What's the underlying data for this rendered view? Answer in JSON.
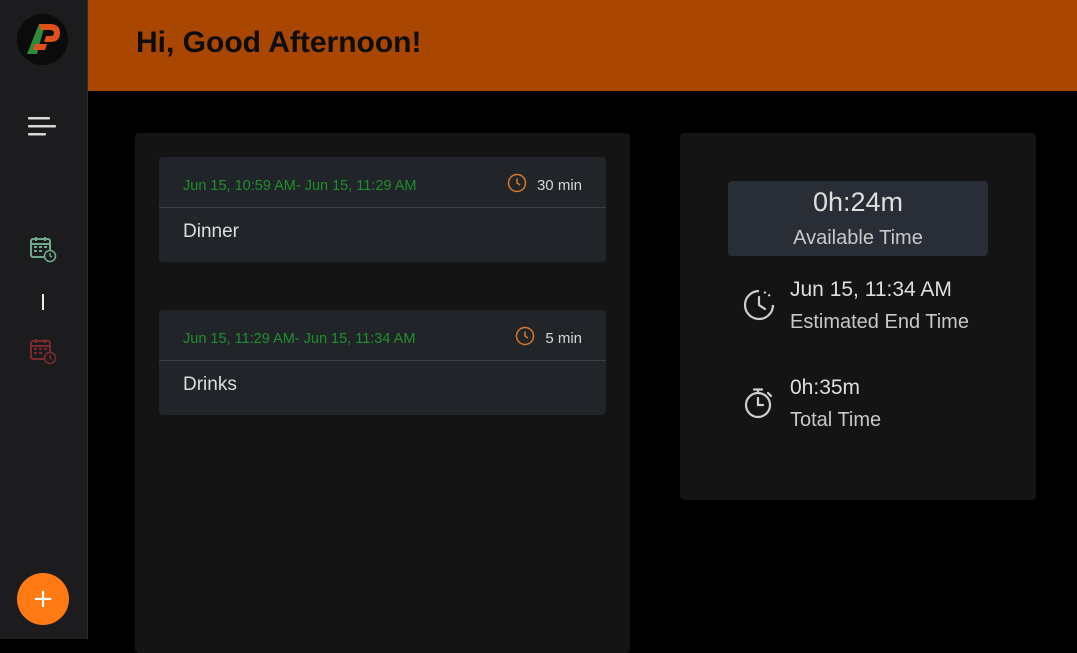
{
  "sidebar": {
    "logo": "ap-logo",
    "menu_icon": "hamburger-menu-icon",
    "nav_items": [
      {
        "icon": "calendar-clock-icon",
        "color": "#6fa88a"
      },
      {
        "icon": "calendar-clock-icon",
        "color": "#7a2a2a"
      }
    ],
    "fab_label": "+",
    "fab_color": "#ff7a12"
  },
  "header": {
    "greeting": "Hi, Good Afternoon!",
    "background": "#a94600"
  },
  "tasks": [
    {
      "range": "Jun 15, 10:59 AM- Jun 15, 11:29 AM",
      "duration": "30 min",
      "name": "Dinner"
    },
    {
      "range": "Jun 15, 11:29 AM- Jun 15, 11:34 AM",
      "duration": "5 min",
      "name": "Drinks"
    }
  ],
  "summary": {
    "available_value": "0h:24m",
    "available_label": "Available Time",
    "end_value": "Jun 15, 11:34 AM",
    "end_label": "Estimated End Time",
    "total_value": "0h:35m",
    "total_label": "Total Time"
  },
  "colors": {
    "range_text": "#1f8f2d",
    "clock_icon": "#d9782b",
    "card_bg": "#212429"
  }
}
